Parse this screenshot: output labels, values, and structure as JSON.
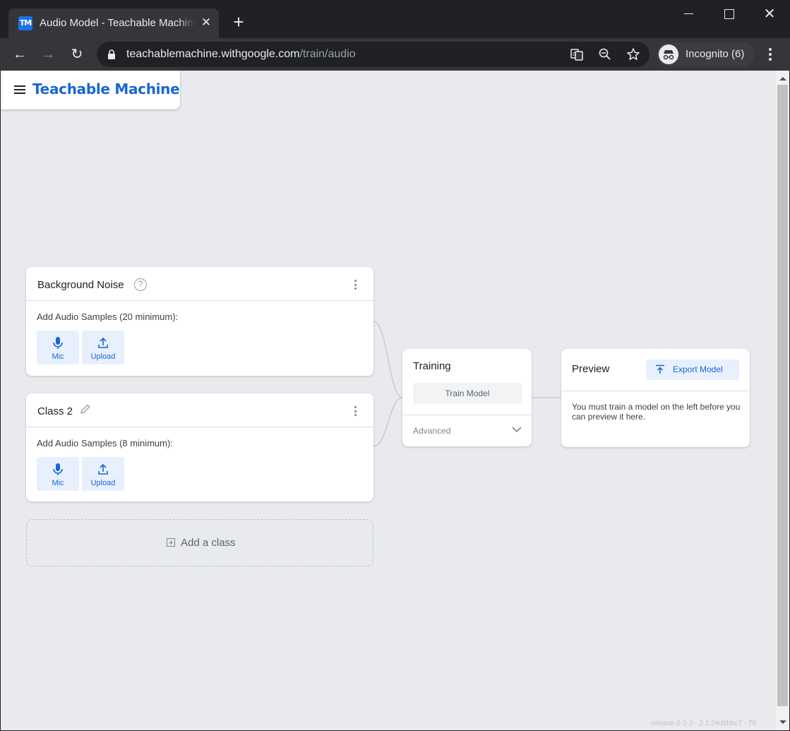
{
  "browser": {
    "tab": {
      "favicon_text": "TM",
      "title": "Audio Model - Teachable Machine",
      "close_glyph": "✕"
    },
    "new_tab_glyph": "+",
    "window": {
      "close_glyph": "✕"
    },
    "nav": {
      "back_glyph": "←",
      "forward_glyph": "→",
      "reload_glyph": "↻"
    },
    "url": {
      "host": "teachablemachine.withgoogle.com",
      "path": "/train/audio"
    },
    "incognito_label": "Incognito (6)"
  },
  "app": {
    "brand": "Teachable Machine",
    "classes": [
      {
        "name": "Background Noise",
        "samples_label": "Add Audio Samples (20 minimum):",
        "mic_label": "Mic",
        "upload_label": "Upload"
      },
      {
        "name": "Class 2",
        "samples_label": "Add Audio Samples (8 minimum):",
        "mic_label": "Mic",
        "upload_label": "Upload"
      }
    ],
    "add_class_label": "Add a class",
    "training": {
      "title": "Training",
      "train_button": "Train Model",
      "advanced_label": "Advanced"
    },
    "preview": {
      "title": "Preview",
      "export_button": "Export Model",
      "message": "You must train a model on the left before you can preview it here."
    },
    "version": "release-2-1-2 - 2.1.2#d9bbc7 - 79"
  },
  "colors": {
    "brand": "#1967d2",
    "page_bg": "#e8eaed",
    "button_tint": "#e8f0fe"
  },
  "icons": [
    "tm-favicon",
    "lock-icon",
    "translate-icon",
    "zoom-out-icon",
    "star-icon",
    "incognito-icon",
    "menu-icon",
    "help-icon",
    "edit-icon",
    "more-vert-icon",
    "mic-icon",
    "upload-icon",
    "add-box-icon",
    "chevron-down-icon",
    "export-icon"
  ]
}
